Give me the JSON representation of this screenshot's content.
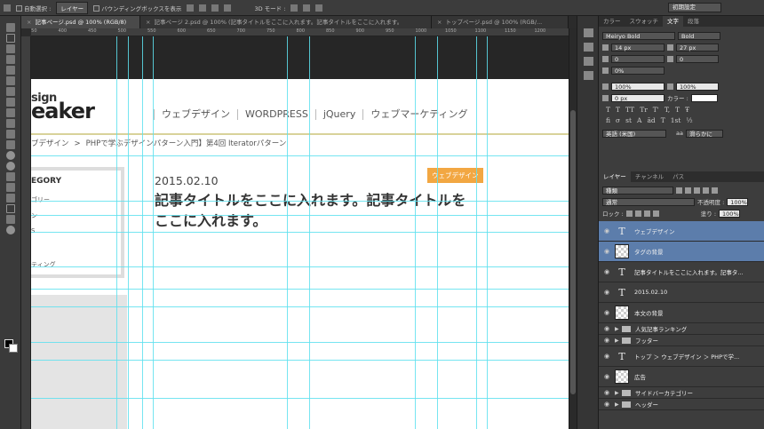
{
  "options_bar": {
    "auto_select_label": "自動選択 :",
    "auto_select_value": "レイヤー",
    "bounding_box_label": "バウンディングボックスを表示",
    "mode_3d_label": "3D モード :",
    "preset": "初期設定"
  },
  "tabs": [
    {
      "label": "記事ページ.psd @ 100% (RGB/8)",
      "active": true
    },
    {
      "label": "記事ページ 2.psd @ 100% (記事タイトルをここに入れます。記事タイトルをここに入れます。",
      "active": false
    },
    {
      "label": "トップページ.psd @ 100% (RGB/...",
      "active": false
    }
  ],
  "ruler": [
    "350",
    "400",
    "450",
    "500",
    "550",
    "600",
    "650",
    "700",
    "750",
    "800",
    "850",
    "900",
    "950",
    "1000",
    "1050",
    "1100",
    "1150",
    "1200"
  ],
  "page": {
    "logo_small": "sign",
    "logo_big": "eaker",
    "nav": [
      "ウェブデザイン",
      "WORDPRESS",
      "jQuery",
      "ウェブマーケティング"
    ],
    "breadcrumb": [
      "ブデザイン",
      "PHPで学ぶデザインパターン入門】第4回 Iteratorパターン"
    ],
    "breadcrumb_sep": ">",
    "sidebar_title": "EGORY",
    "sidebar_items": [
      "ゴリー",
      "ン",
      "S",
      "ティング"
    ],
    "post_date": "2015.02.10",
    "post_title": "記事タイトルをここに入れます。記事タイトルをここに入れます。",
    "category_badge": "ウェブデザイン"
  },
  "char_panel": {
    "tabs": [
      "カラー",
      "スウォッチ",
      "文字",
      "段落"
    ],
    "font_family": "Meiryo Bold",
    "font_style": "Bold",
    "font_size": "14 px",
    "leading": "27 px",
    "kerning": "0",
    "tracking": "0",
    "tsume": "0%",
    "vscale": "100%",
    "hscale": "100%",
    "baseline": "0 px",
    "color_label": "カラー :",
    "styles": [
      "T",
      "T",
      "TT",
      "Tr",
      "T'",
      "T,",
      "T",
      "Ŧ"
    ],
    "ot_glyphs": [
      "fi",
      "σ",
      "st",
      "A",
      "ād",
      "T",
      "1st",
      "½"
    ],
    "language": "英語 (米国)",
    "aa_label": "aa",
    "aa_value": "滑らかに"
  },
  "layers_panel": {
    "tabs": [
      "レイヤー",
      "チャンネル",
      "パス"
    ],
    "filter": "種類",
    "blend_mode": "通常",
    "opacity_label": "不透明度 :",
    "opacity": "100%",
    "lock_label": "ロック :",
    "fill_label": "塗り :",
    "fill": "100%",
    "layers": [
      {
        "name": "ウェブデザイン",
        "kind": "text",
        "selected": true
      },
      {
        "name": "タグの背景",
        "kind": "image",
        "selected": true
      },
      {
        "name": "記事タイトルをここに入れます。記事タ...",
        "kind": "text",
        "selected": false
      },
      {
        "name": "2015.02.10",
        "kind": "text",
        "selected": false
      },
      {
        "name": "本文の背景",
        "kind": "image",
        "selected": false
      },
      {
        "name": "人気記事ランキング",
        "kind": "group",
        "selected": false
      },
      {
        "name": "フッター",
        "kind": "group",
        "selected": false
      },
      {
        "name": "トップ ＞ ウェブデザイン ＞ PHPで学...",
        "kind": "text",
        "selected": false
      },
      {
        "name": "広告",
        "kind": "image",
        "selected": false
      },
      {
        "name": "サイドバーカテゴリー",
        "kind": "group",
        "selected": false
      },
      {
        "name": "ヘッダー",
        "kind": "group",
        "selected": false
      }
    ]
  },
  "colors": {
    "guide": "#5ee0ef",
    "badge": "#f2a742",
    "selection": "#5c7dab"
  }
}
